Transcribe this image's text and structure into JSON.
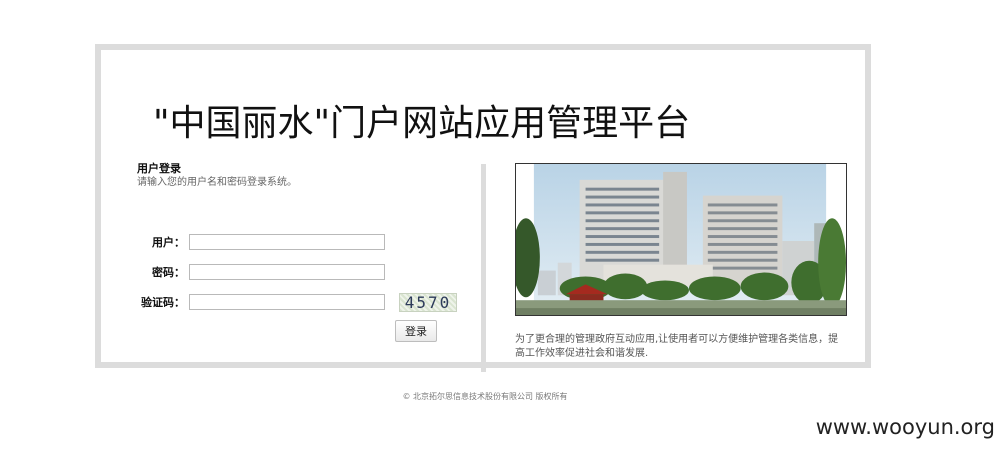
{
  "header": {
    "title": "\"中国丽水\"门户网站应用管理平台"
  },
  "login": {
    "heading": "用户登录",
    "description": "请输入您的用户名和密码登录系统。",
    "username_label": "用户：",
    "username_value": "",
    "password_label": "密码：",
    "password_value": "",
    "captcha_label": "验证码：",
    "captcha_value": "",
    "captcha_text": "4570",
    "submit_label": "登录"
  },
  "intro": {
    "text": "为了更合理的管理政府互动应用,让使用者可以方便维护管理各类信息，提高工作效率促进社会和谐发展."
  },
  "footer": {
    "copyright": "© 北京拓尔思信息技术股份有限公司 版权所有"
  },
  "watermark": {
    "text": "www.wooyun.org"
  }
}
